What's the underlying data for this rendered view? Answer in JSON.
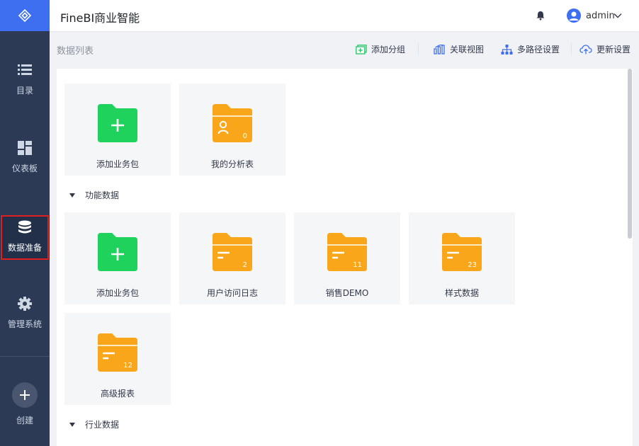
{
  "header": {
    "app_title": "FineBI商业智能",
    "username": "admin"
  },
  "sidebar": {
    "items": [
      {
        "label": "目录",
        "icon": "list-icon"
      },
      {
        "label": "仪表板",
        "icon": "dashboard-icon"
      },
      {
        "label": "数据准备",
        "icon": "database-icon",
        "active": true
      },
      {
        "label": "管理系统",
        "icon": "gear-icon"
      }
    ],
    "create_label": "创建"
  },
  "toolbar": {
    "title": "数据列表",
    "add_group": "添加分组",
    "relation_view": "关联视图",
    "multipath": "多路径设置",
    "update": "更新设置"
  },
  "top_cards": [
    {
      "label": "添加业务包",
      "type": "add"
    },
    {
      "label": "我的分析表",
      "type": "user-folder",
      "count": "0"
    }
  ],
  "sections": [
    {
      "title": "功能数据"
    },
    {
      "title": "行业数据"
    }
  ],
  "function_cards": [
    {
      "label": "添加业务包",
      "type": "add"
    },
    {
      "label": "用户访问日志",
      "type": "folder",
      "count": "2"
    },
    {
      "label": "销售DEMO",
      "type": "folder",
      "count": "11"
    },
    {
      "label": "样式数据",
      "type": "folder",
      "count": "23"
    },
    {
      "label": "高级报表",
      "type": "folder",
      "count": "12"
    }
  ],
  "colors": {
    "accent": "#3d6ff0",
    "sidebar": "#2d3a55",
    "folder": "#faa61a",
    "add": "#1fd25b",
    "active_outline": "#e02020"
  }
}
